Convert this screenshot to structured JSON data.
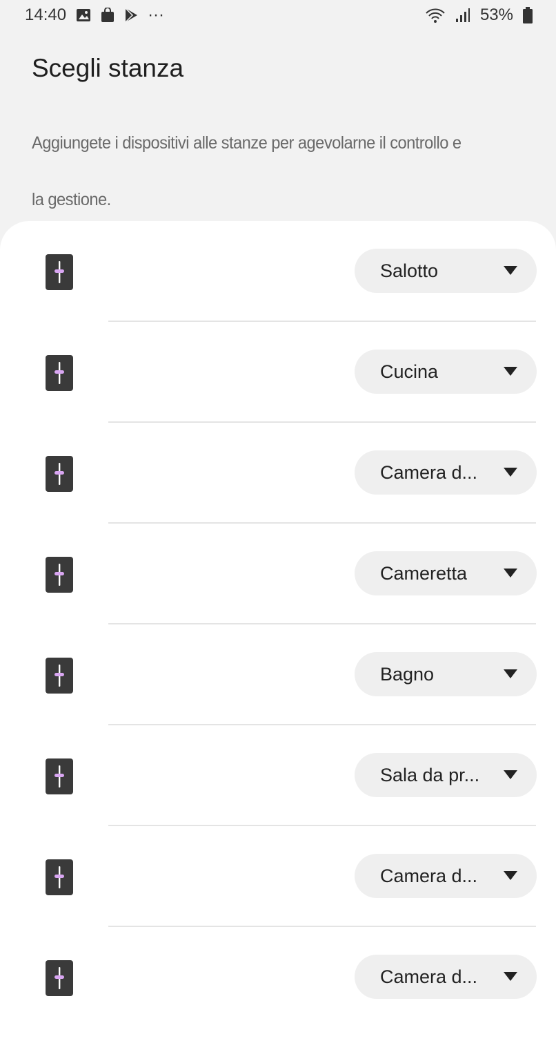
{
  "status_bar": {
    "time": "14:40",
    "more_dots": "···",
    "battery_percent": "53%"
  },
  "header": {
    "title": "Scegli stanza",
    "description_line1": "Aggiungete i dispositivi alle stanze per agevolarne il controllo e",
    "description_line2": "la gestione."
  },
  "colors": {
    "background": "#f2f2f2",
    "card": "#ffffff",
    "device_icon_bg": "#3a3a3a",
    "device_icon_accent": "#d9a6f2",
    "dropdown_bg": "#efefef"
  },
  "devices": [
    {
      "icon": "device-icon",
      "room": "Salotto"
    },
    {
      "icon": "device-icon",
      "room": "Cucina"
    },
    {
      "icon": "device-icon",
      "room": "Camera d..."
    },
    {
      "icon": "device-icon",
      "room": "Cameretta"
    },
    {
      "icon": "device-icon",
      "room": "Bagno"
    },
    {
      "icon": "device-icon",
      "room": "Sala da pr..."
    },
    {
      "icon": "device-icon",
      "room": "Camera d..."
    },
    {
      "icon": "device-icon",
      "room": "Camera d..."
    }
  ]
}
